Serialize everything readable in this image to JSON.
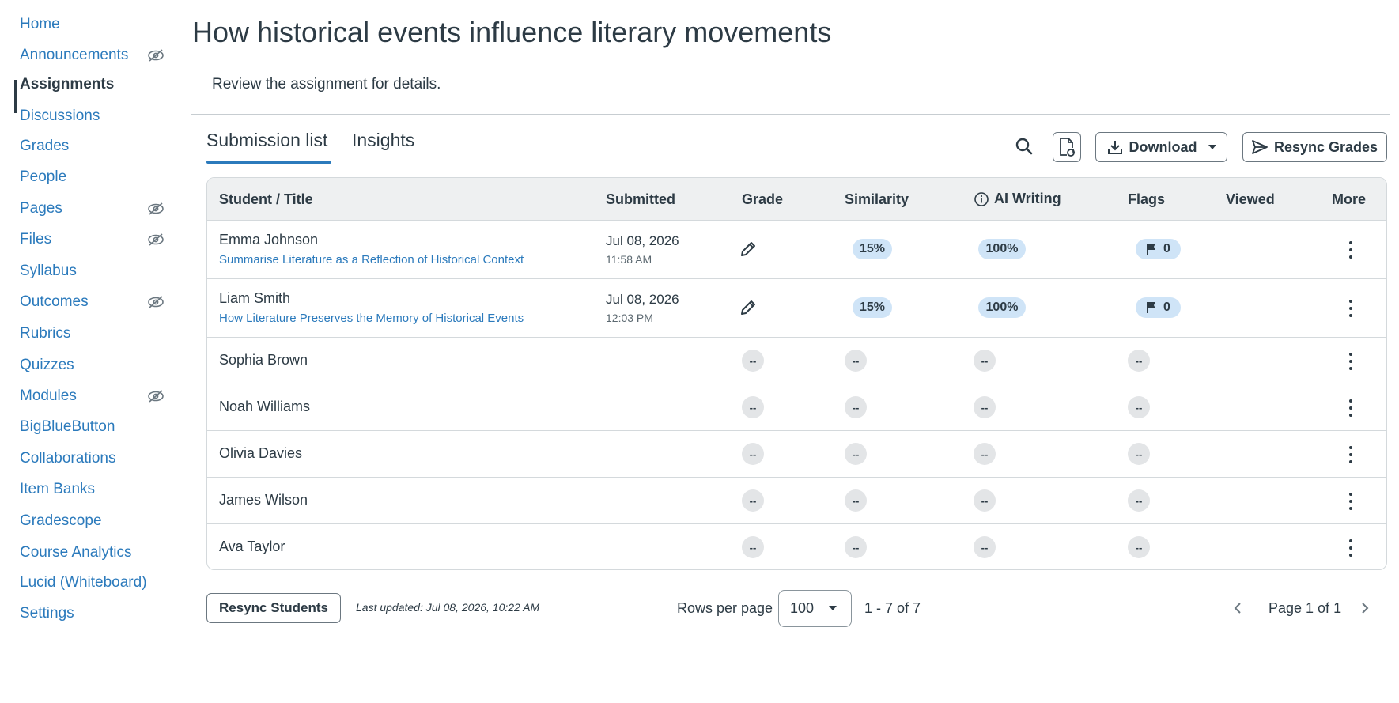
{
  "sidebar": {
    "items": [
      {
        "label": "Home",
        "active": false,
        "hidden": false
      },
      {
        "label": "Announcements",
        "active": false,
        "hidden": true
      },
      {
        "label": "Assignments",
        "active": true,
        "hidden": false
      },
      {
        "label": "Discussions",
        "active": false,
        "hidden": false
      },
      {
        "label": "Grades",
        "active": false,
        "hidden": false
      },
      {
        "label": "People",
        "active": false,
        "hidden": false
      },
      {
        "label": "Pages",
        "active": false,
        "hidden": true
      },
      {
        "label": "Files",
        "active": false,
        "hidden": true
      },
      {
        "label": "Syllabus",
        "active": false,
        "hidden": false
      },
      {
        "label": "Outcomes",
        "active": false,
        "hidden": true
      },
      {
        "label": "Rubrics",
        "active": false,
        "hidden": false
      },
      {
        "label": "Quizzes",
        "active": false,
        "hidden": false
      },
      {
        "label": "Modules",
        "active": false,
        "hidden": true
      },
      {
        "label": "BigBlueButton",
        "active": false,
        "hidden": false
      },
      {
        "label": "Collaborations",
        "active": false,
        "hidden": false
      },
      {
        "label": "Item Banks",
        "active": false,
        "hidden": false
      },
      {
        "label": "Gradescope",
        "active": false,
        "hidden": false
      },
      {
        "label": "Course Analytics",
        "active": false,
        "hidden": false
      },
      {
        "label": "Lucid (Whiteboard)",
        "active": false,
        "hidden": false
      },
      {
        "label": "Settings",
        "active": false,
        "hidden": false
      }
    ]
  },
  "header": {
    "title": "How historical events influence literary movements",
    "subtitle": "Review the assignment for details."
  },
  "tabs": [
    {
      "label": "Submission list",
      "active": true
    },
    {
      "label": "Insights",
      "active": false
    }
  ],
  "toolbar": {
    "search_icon": "search-icon",
    "file_sync_icon": "file-refresh-icon",
    "download_label": "Download",
    "resync_grades_label": "Resync Grades"
  },
  "table": {
    "columns": [
      "Student / Title",
      "Submitted",
      "Grade",
      "Similarity",
      "AI Writing",
      "Flags",
      "Viewed",
      "More"
    ],
    "rows": [
      {
        "student": "Emma Johnson",
        "title": "Summarise Literature as a Reflection of Historical Context",
        "date": "Jul 08, 2026",
        "time": "11:58 AM",
        "grade": "edit",
        "similarity": "15%",
        "ai_writing": "100%",
        "flags": "0"
      },
      {
        "student": "Liam Smith",
        "title": "How Literature Preserves the Memory of Historical Events",
        "date": "Jul 08, 2026",
        "time": "12:03 PM",
        "grade": "edit",
        "similarity": "15%",
        "ai_writing": "100%",
        "flags": "0"
      },
      {
        "student": "Sophia Brown",
        "title": "",
        "date": "",
        "time": "",
        "grade": "--",
        "similarity": "--",
        "ai_writing": "--",
        "flags": "--"
      },
      {
        "student": "Noah Williams",
        "title": "",
        "date": "",
        "time": "",
        "grade": "--",
        "similarity": "--",
        "ai_writing": "--",
        "flags": "--"
      },
      {
        "student": "Olivia Davies",
        "title": "",
        "date": "",
        "time": "",
        "grade": "--",
        "similarity": "--",
        "ai_writing": "--",
        "flags": "--"
      },
      {
        "student": "James Wilson",
        "title": "",
        "date": "",
        "time": "",
        "grade": "--",
        "similarity": "--",
        "ai_writing": "--",
        "flags": "--"
      },
      {
        "student": "Ava Taylor",
        "title": "",
        "date": "",
        "time": "",
        "grade": "--",
        "similarity": "--",
        "ai_writing": "--",
        "flags": "--"
      }
    ]
  },
  "footer": {
    "resync_students_label": "Resync Students",
    "last_updated": "Last updated: Jul 08, 2026, 10:22 AM",
    "rows_per_page_label": "Rows per page",
    "rows_per_page_value": "100",
    "range_text": "1 - 7 of 7",
    "page_text": "Page 1 of 1"
  },
  "colors": {
    "link": "#2b7abc",
    "text": "#2d3b45",
    "pill": "#cfe4f7",
    "header_bg": "#eef0f1"
  }
}
